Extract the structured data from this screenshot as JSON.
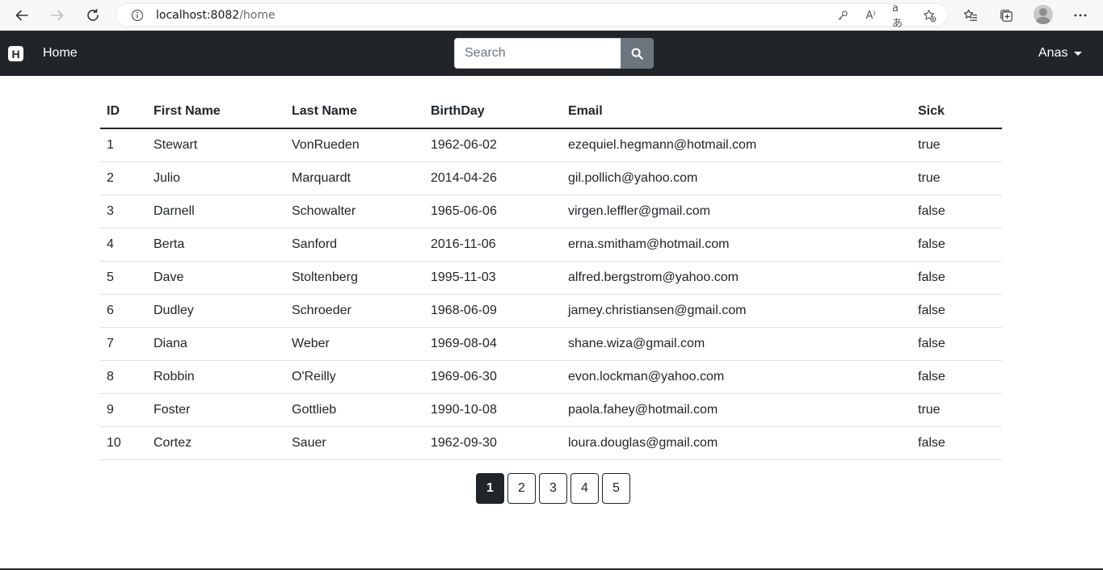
{
  "browser": {
    "url_host": "localhost:8082",
    "url_path": "/home",
    "read_aloud_icon": "A⁾",
    "translate_icon": "aあ"
  },
  "navbar": {
    "brand_letter": "H",
    "home_label": "Home",
    "search_placeholder": "Search",
    "user_label": "Anas"
  },
  "table": {
    "headers": [
      "ID",
      "First Name",
      "Last Name",
      "BirthDay",
      "Email",
      "Sick"
    ],
    "rows": [
      [
        "1",
        "Stewart",
        "VonRueden",
        "1962-06-02",
        "ezequiel.hegmann@hotmail.com",
        "true"
      ],
      [
        "2",
        "Julio",
        "Marquardt",
        "2014-04-26",
        "gil.pollich@yahoo.com",
        "true"
      ],
      [
        "3",
        "Darnell",
        "Schowalter",
        "1965-06-06",
        "virgen.leffler@gmail.com",
        "false"
      ],
      [
        "4",
        "Berta",
        "Sanford",
        "2016-11-06",
        "erna.smitham@hotmail.com",
        "false"
      ],
      [
        "5",
        "Dave",
        "Stoltenberg",
        "1995-11-03",
        "alfred.bergstrom@yahoo.com",
        "false"
      ],
      [
        "6",
        "Dudley",
        "Schroeder",
        "1968-06-09",
        "jamey.christiansen@gmail.com",
        "false"
      ],
      [
        "7",
        "Diana",
        "Weber",
        "1969-08-04",
        "shane.wiza@gmail.com",
        "false"
      ],
      [
        "8",
        "Robbin",
        "O'Reilly",
        "1969-06-30",
        "evon.lockman@yahoo.com",
        "false"
      ],
      [
        "9",
        "Foster",
        "Gottlieb",
        "1990-10-08",
        "paola.fahey@hotmail.com",
        "true"
      ],
      [
        "10",
        "Cortez",
        "Sauer",
        "1962-09-30",
        "loura.douglas@gmail.com",
        "false"
      ]
    ]
  },
  "pagination": {
    "pages": [
      "1",
      "2",
      "3",
      "4",
      "5"
    ],
    "active": "1"
  },
  "colors": {
    "navbar_bg": "#212529",
    "search_button_bg": "#6c757d"
  }
}
